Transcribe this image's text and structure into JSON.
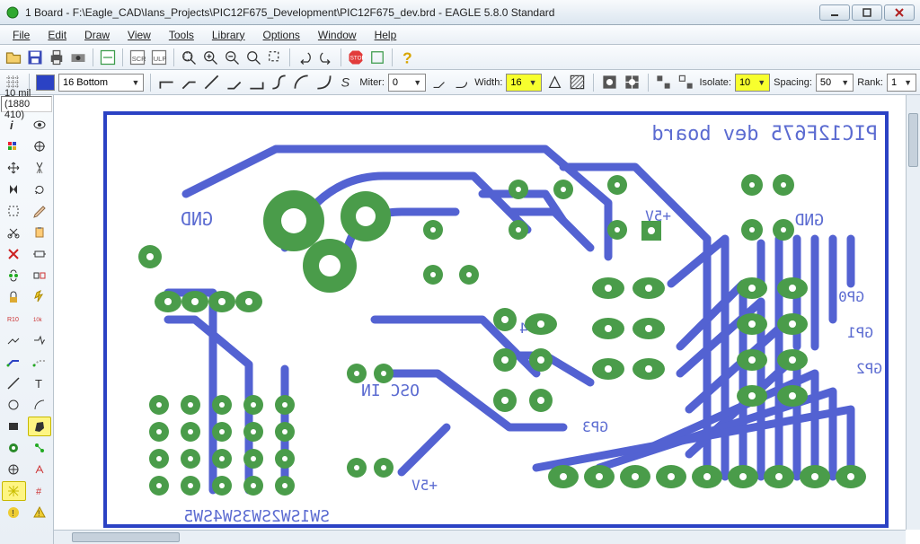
{
  "window": {
    "title": "1 Board - F:\\Eagle_CAD\\Ians_Projects\\PIC12F675_Development\\PIC12F675_dev.brd - EAGLE 5.8.0 Standard"
  },
  "menu": {
    "file": "File",
    "edit": "Edit",
    "draw": "Draw",
    "view": "View",
    "tools": "Tools",
    "library": "Library",
    "options": "Options",
    "window": "Window",
    "help": "Help"
  },
  "layer": {
    "name": "16 Bottom"
  },
  "props": {
    "miter_label": "Miter:",
    "miter_value": "0",
    "width_label": "Width:",
    "width_value": "16",
    "isolate_label": "Isolate:",
    "isolate_value": "10",
    "spacing_label": "Spacing:",
    "spacing_value": "50",
    "rank_label": "Rank:",
    "rank_value": "1"
  },
  "coords": "10 mil (1880 410)",
  "board": {
    "labels": {
      "title": "PIC12F675 dev board",
      "gnd1": "GND",
      "gnd2": "GND",
      "p5v1": "+5V",
      "p5v2": "+5V",
      "osc": "OSC IN",
      "gp0": "GP0",
      "gp1": "GP1",
      "gp2": "GP2",
      "gp3": "GP3",
      "gp4": "GP4",
      "sw": "SW1SW2SW3SW4SW5"
    }
  }
}
